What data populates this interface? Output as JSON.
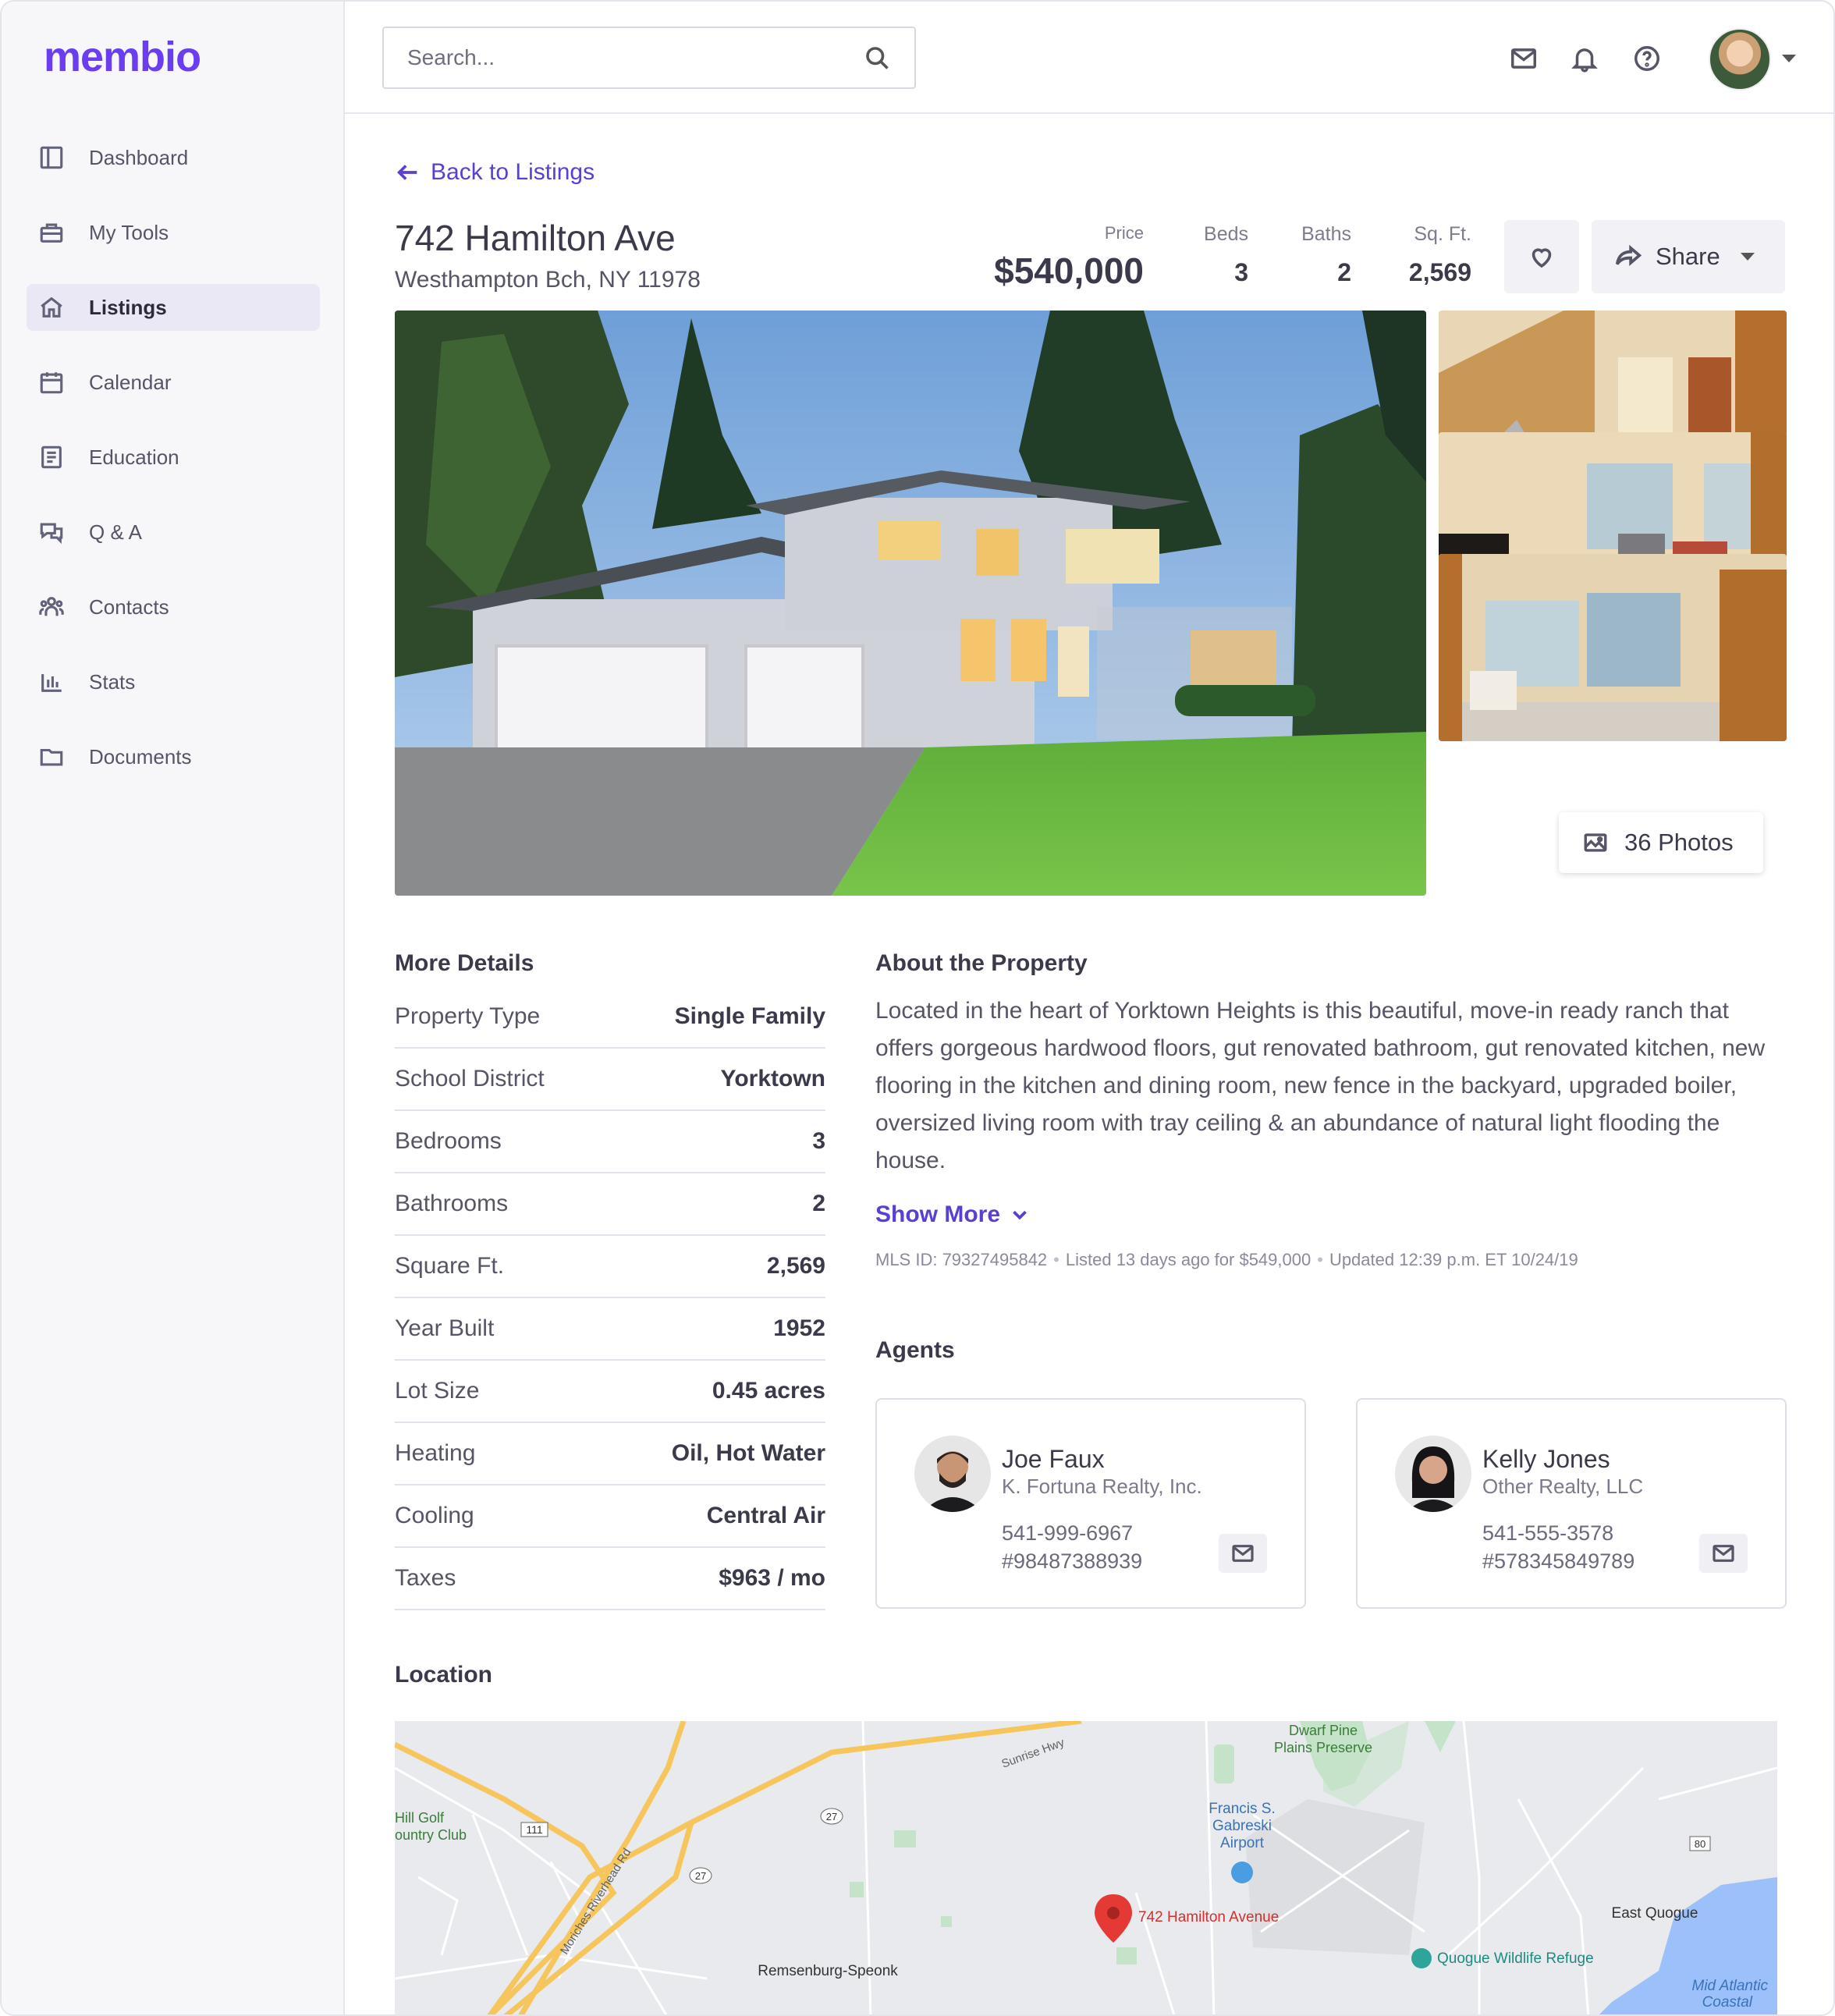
{
  "app": {
    "logo": "membi",
    "logo_suffix": "o"
  },
  "sidebar": {
    "items": [
      {
        "label": "Dashboard",
        "icon": "dashboard-icon"
      },
      {
        "label": "My Tools",
        "icon": "toolbox-icon"
      },
      {
        "label": "Listings",
        "icon": "home-icon",
        "active": true
      },
      {
        "label": "Calendar",
        "icon": "calendar-icon"
      },
      {
        "label": "Education",
        "icon": "book-icon"
      },
      {
        "label": "Q & A",
        "icon": "chat-icon"
      },
      {
        "label": "Contacts",
        "icon": "contacts-icon"
      },
      {
        "label": "Stats",
        "icon": "stats-icon"
      },
      {
        "label": "Documents",
        "icon": "folder-icon"
      }
    ]
  },
  "header": {
    "search_placeholder": "Search..."
  },
  "listing": {
    "back_label": "Back to Listings",
    "address": "742 Hamilton Ave",
    "city": "Westhampton Bch, NY 11978",
    "price_label": "Price",
    "price": "$540,000",
    "beds_label": "Beds",
    "beds": "3",
    "baths_label": "Baths",
    "baths": "2",
    "sqft_label": "Sq. Ft.",
    "sqft": "2,569",
    "share_label": "Share",
    "photos_label": "36 Photos"
  },
  "details": {
    "title": "More Details",
    "rows": [
      {
        "k": "Property Type",
        "v": "Single Family"
      },
      {
        "k": "School District",
        "v": "Yorktown"
      },
      {
        "k": "Bedrooms",
        "v": "3"
      },
      {
        "k": "Bathrooms",
        "v": "2"
      },
      {
        "k": "Square Ft.",
        "v": "2,569"
      },
      {
        "k": "Year Built",
        "v": "1952"
      },
      {
        "k": "Lot Size",
        "v": "0.45 acres"
      },
      {
        "k": "Heating",
        "v": "Oil, Hot Water"
      },
      {
        "k": "Cooling",
        "v": "Central Air"
      },
      {
        "k": "Taxes",
        "v": "$963 / mo"
      }
    ]
  },
  "about": {
    "title": "About the Property",
    "text": "Located in the heart of Yorktown Heights is this beautiful, move-in ready ranch that offers gorgeous hardwood floors, gut renovated bathroom, gut renovated kitchen, new flooring in the kitchen and dining room, new fence in the backyard, upgraded boiler, oversized living room with tray ceiling & an abundance of natural light flooding the house.",
    "show_more": "Show More",
    "mls": "MLS ID: 79327495842",
    "listed": "Listed 13 days ago for $549,000",
    "updated": "Updated 12:39 p.m. ET 10/24/19"
  },
  "agents": {
    "title": "Agents",
    "list": [
      {
        "name": "Joe Faux",
        "company": "K. Fortuna Realty, Inc.",
        "phone": "541-999-6967",
        "id": "#98487388939"
      },
      {
        "name": "Kelly Jones",
        "company": "Other Realty, LLC",
        "phone": "541-555-3578",
        "id": "#578345849789"
      }
    ]
  },
  "location": {
    "title": "Location",
    "map_labels": {
      "marker": "742 Hamilton Avenue",
      "preserve": "Dwarf Pine",
      "preserve2": "Plains Preserve",
      "airport1": "Francis S.",
      "airport2": "Gabreski",
      "airport3": "Airport",
      "golf1": "Hill Golf",
      "golf2": "ountry Club",
      "remsenburg": "Remsenburg-Speonk",
      "east_quogue": "East Quogue",
      "refuge": "Quogue Wildlife Refuge",
      "mid1": "Mid Atlantic",
      "mid2": "Coastal",
      "sunrise": "Sunrise Hwy",
      "r27a": "27",
      "r27b": "27",
      "r111": "111",
      "r80": "80",
      "riverhead": "Moriches Riverhead Rd"
    }
  },
  "colors": {
    "accent": "#5a3fd0",
    "brand": "#6a3df0"
  }
}
